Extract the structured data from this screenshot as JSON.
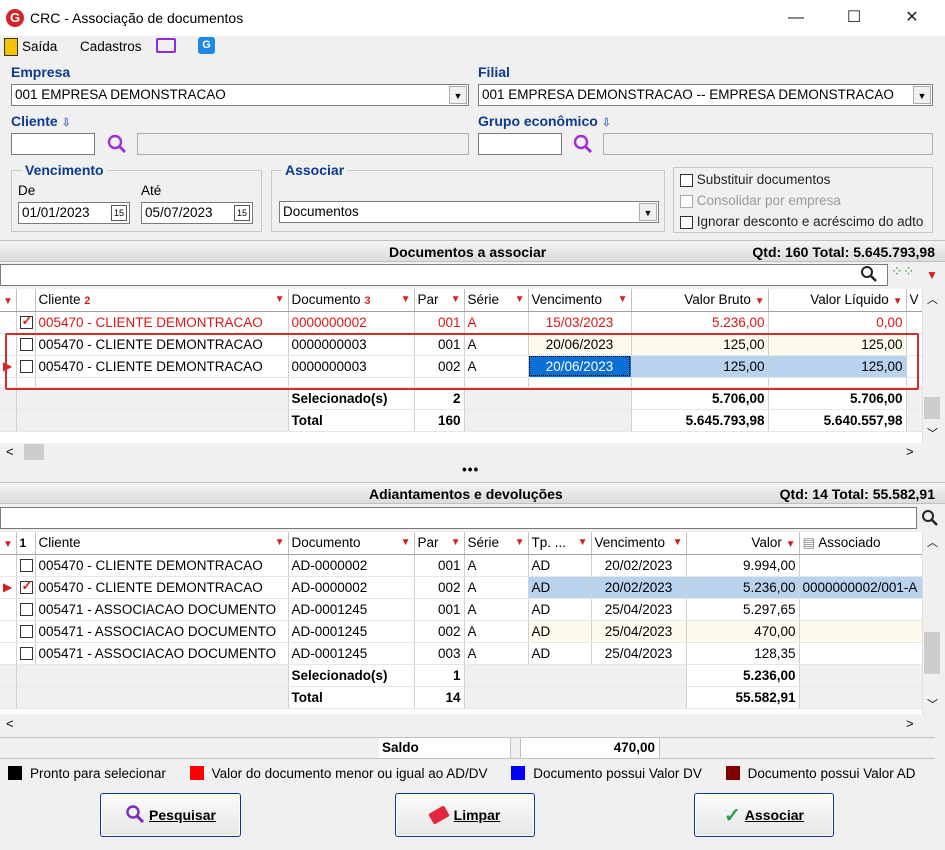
{
  "window": {
    "title": "CRC - Associação de documentos",
    "logo": "G",
    "min": "—",
    "max": "☐",
    "close": "✕"
  },
  "menu": {
    "saida": "Saída",
    "cadastros": "Cadastros"
  },
  "empresa": {
    "label": "Empresa",
    "value": "001 EMPRESA DEMONSTRACAO"
  },
  "filial": {
    "label": "Filial",
    "value": "001 EMPRESA DEMONSTRACAO -- EMPRESA DEMONSTRACAO"
  },
  "cliente": {
    "label": "Cliente",
    "value": "",
    "name": ""
  },
  "grupo": {
    "label": "Grupo econômico",
    "value": "",
    "name": ""
  },
  "vencimento": {
    "label": "Vencimento",
    "de_label": "De",
    "de": "01/01/2023",
    "ate_label": "Até",
    "ate": "05/07/2023"
  },
  "associar": {
    "label": "Associar",
    "value": "Documentos"
  },
  "options": {
    "substituir": "Substituir documentos",
    "consolidar": "Consolidar por empresa",
    "ignorar": "Ignorar desconto e acréscimo do adto"
  },
  "docs": {
    "title": "Documentos a associar",
    "summary": "Qtd: 160 Total: 5.645.793,98",
    "cols": {
      "cliente": "Cliente",
      "cliente_sort": "2",
      "documento": "Documento",
      "documento_sort": "3",
      "par": "Par",
      "serie": "Série",
      "vencimento": "Vencimento",
      "bruto": "Valor Bruto",
      "liquido": "Valor Líquido",
      "extra": "V"
    },
    "rows": [
      {
        "cliente": "005470 - CLIENTE DEMONTRACAO",
        "documento": "0000000002",
        "par": "001",
        "serie": "A",
        "venc": "15/03/2023",
        "bruto": "5.236,00",
        "liquido": "0,00"
      },
      {
        "cliente": "005470 - CLIENTE DEMONTRACAO",
        "documento": "0000000003",
        "par": "001",
        "serie": "A",
        "venc": "20/06/2023",
        "bruto": "125,00",
        "liquido": "125,00"
      },
      {
        "cliente": "005470 - CLIENTE DEMONTRACAO",
        "documento": "0000000003",
        "par": "002",
        "serie": "A",
        "venc": "20/06/2023",
        "bruto": "125,00",
        "liquido": "125,00"
      }
    ],
    "sel_label": "Selecionado(s)",
    "sel_qtd": "2",
    "sel_bruto": "5.706,00",
    "sel_liq": "5.706,00",
    "tot_label": "Total",
    "tot_qtd": "160",
    "tot_bruto": "5.645.793,98",
    "tot_liq": "5.640.557,98"
  },
  "splitter": "•••",
  "adtos": {
    "title": "Adiantamentos e devoluções",
    "summary": "Qtd: 14 Total: 55.582,91",
    "cols": {
      "sort": "1",
      "cliente": "Cliente",
      "documento": "Documento",
      "par": "Par",
      "serie": "Série",
      "tp": "Tp. ...",
      "vencimento": "Vencimento",
      "valor": "Valor",
      "associado": "Associado"
    },
    "rows": [
      {
        "cliente": "005470 - CLIENTE DEMONTRACAO",
        "documento": "AD-0000002",
        "par": "001",
        "serie": "A",
        "tp": "AD",
        "venc": "20/02/2023",
        "valor": "9.994,00",
        "assoc": ""
      },
      {
        "cliente": "005470 - CLIENTE DEMONTRACAO",
        "documento": "AD-0000002",
        "par": "002",
        "serie": "A",
        "tp": "AD",
        "venc": "20/02/2023",
        "valor": "5.236,00",
        "assoc": "0000000002/001-A"
      },
      {
        "cliente": "005471 - ASSOCIACAO DOCUMENTO",
        "documento": "AD-0001245",
        "par": "001",
        "serie": "A",
        "tp": "AD",
        "venc": "25/04/2023",
        "valor": "5.297,65",
        "assoc": ""
      },
      {
        "cliente": "005471 - ASSOCIACAO DOCUMENTO",
        "documento": "AD-0001245",
        "par": "002",
        "serie": "A",
        "tp": "AD",
        "venc": "25/04/2023",
        "valor": "470,00",
        "assoc": ""
      },
      {
        "cliente": "005471 - ASSOCIACAO DOCUMENTO",
        "documento": "AD-0001245",
        "par": "003",
        "serie": "A",
        "tp": "AD",
        "venc": "25/04/2023",
        "valor": "128,35",
        "assoc": ""
      }
    ],
    "sel_label": "Selecionado(s)",
    "sel_qtd": "1",
    "sel_valor": "5.236,00",
    "tot_label": "Total",
    "tot_qtd": "14",
    "tot_valor": "55.582,91"
  },
  "saldo": {
    "label": "Saldo",
    "value": "470,00"
  },
  "legend": {
    "black": "Pronto para selecionar",
    "red": "Valor do documento menor ou igual ao AD/DV",
    "blue": "Documento possui Valor DV",
    "darkred": "Documento possui Valor AD"
  },
  "legend_colors": {
    "black": "#000000",
    "red": "#ff0000",
    "blue": "#0000ff",
    "darkred": "#7f0000"
  },
  "buttons": {
    "pesquisar": "Pesquisar",
    "limpar": "Limpar",
    "associar": "Associar"
  }
}
